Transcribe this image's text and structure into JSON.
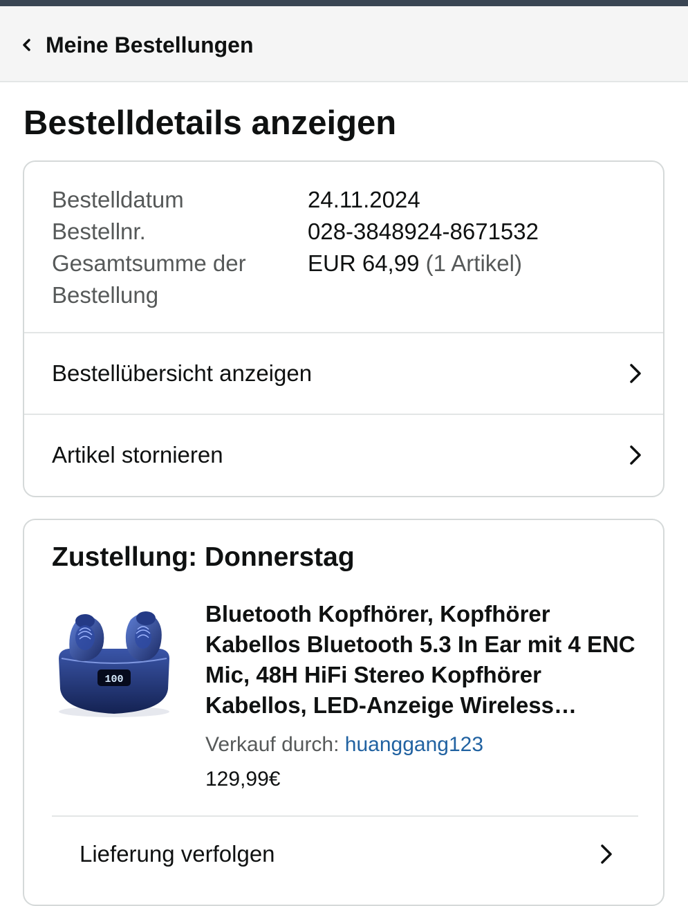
{
  "navbar": {
    "back_label": "Meine Bestellungen",
    "back_icon": "chevron-left-icon",
    "background": "#f5f5f5"
  },
  "page": {
    "title": "Bestelldetails anzeigen"
  },
  "order_summary": {
    "rows": [
      {
        "label": "Bestelldatum",
        "value": "24.11.2024"
      },
      {
        "label": "Bestellnr.",
        "value": "028-3848924-8671532"
      },
      {
        "label": "Gesamtsumme der Bestellung",
        "value": "EUR 64,99",
        "value_suffix": "(1 Artikel)"
      }
    ],
    "links": [
      {
        "label": "Bestellübersicht anzeigen",
        "icon": "chevron-right-icon"
      },
      {
        "label": "Artikel stornieren",
        "icon": "chevron-right-icon"
      }
    ]
  },
  "delivery": {
    "title": "Zustellung: Donnerstag",
    "product": {
      "title": "Bluetooth Kopfhörer, Kopfhörer Kabellos Bluetooth 5.3 In Ear mit 4 ENC Mic, 48H HiFi Stereo Kopfhörer Kabellos, LED-Anzeige Wireless Earbuds",
      "seller_prefix": "Verkauf durch: ",
      "seller": "huanggang123",
      "price": "129,99€",
      "image_icon": "earbuds-product-image",
      "display_text": "100"
    },
    "track_label": "Lieferung verfolgen",
    "track_icon": "chevron-right-icon"
  },
  "colors": {
    "link": "#2162a1",
    "muted_text": "#565959",
    "text": "#0f1111",
    "border": "#d5d9d9",
    "top_strip": "#3a4553"
  }
}
